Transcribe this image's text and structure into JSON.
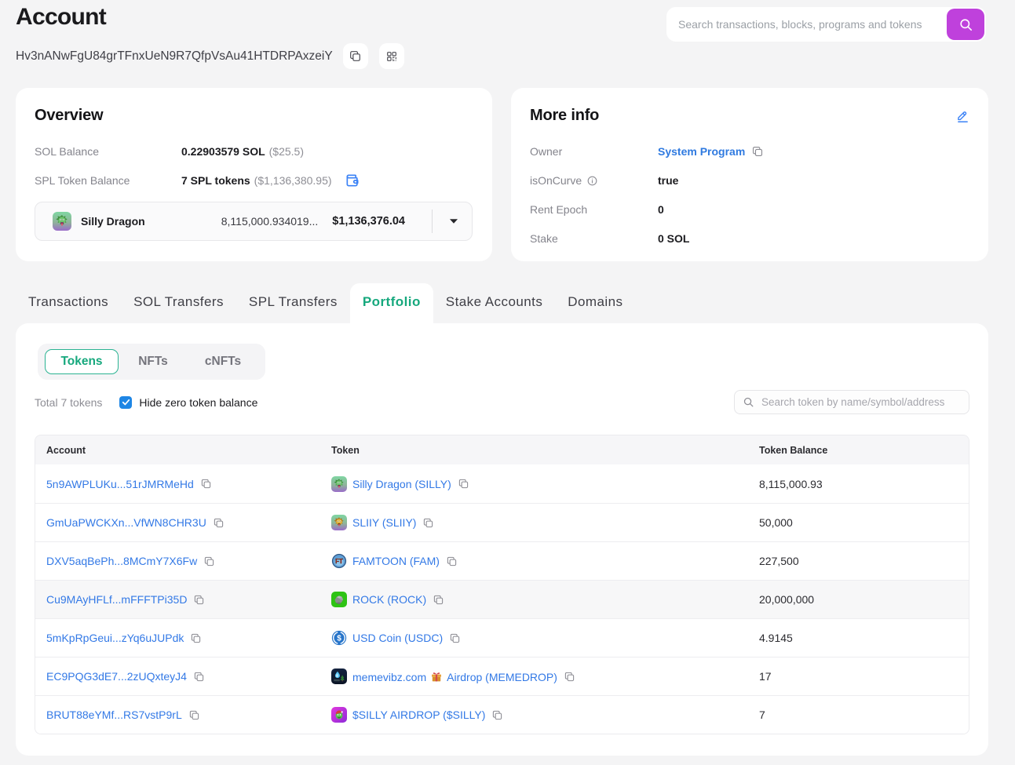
{
  "page": {
    "title": "Account"
  },
  "colors": {
    "page_background": "#f4f4f5",
    "accent_purple": "#bf41dc",
    "accent_green": "#16a87d",
    "link_blue": "#3379e6",
    "checkbox_blue": "#1e86e5",
    "icon_blue": "#3b82f6"
  },
  "top_search": {
    "placeholder": "Search transactions, blocks, programs and tokens"
  },
  "account": {
    "address": "Hv3nANwFgU84grTFnxUeN9R7QfpVsAu41HTDRPAxzeiY"
  },
  "overview": {
    "title": "Overview",
    "sol_balance": {
      "label": "SOL Balance",
      "value": "0.22903579 SOL",
      "usd": "($25.5)"
    },
    "spl_balance": {
      "label": "SPL Token Balance",
      "value": "7 SPL tokens",
      "usd": "($1,136,380.95)"
    },
    "token_select": {
      "name": "Silly Dragon",
      "amount": "8,115,000.934019...",
      "usd": "$1,136,376.04"
    }
  },
  "more_info": {
    "title": "More info",
    "rows": [
      {
        "label": "Owner",
        "value": "System Program"
      },
      {
        "label": "isOnCurve",
        "value": "true"
      },
      {
        "label": "Rent Epoch",
        "value": "0"
      },
      {
        "label": "Stake",
        "value": "0 SOL"
      }
    ]
  },
  "tabs": [
    {
      "label": "Transactions",
      "active": false
    },
    {
      "label": "SOL Transfers",
      "active": false
    },
    {
      "label": "SPL Transfers",
      "active": false
    },
    {
      "label": "Portfolio",
      "active": true
    },
    {
      "label": "Stake Accounts",
      "active": false
    },
    {
      "label": "Domains",
      "active": false
    }
  ],
  "portfolio": {
    "subtabs": [
      {
        "label": "Tokens",
        "active": true
      },
      {
        "label": "NFTs",
        "active": false
      },
      {
        "label": "cNFTs",
        "active": false
      }
    ],
    "total_text": "Total 7 tokens",
    "hide_zero": {
      "label": "Hide zero token balance",
      "checked": true
    },
    "token_search_placeholder": "Search token by name/symbol/address",
    "table": {
      "headers": [
        "Account",
        "Token",
        "Token Balance"
      ],
      "rows": [
        {
          "account": "5n9AWPLUKu...51rJMRMeHd",
          "token": "Silly Dragon (SILLY)",
          "balance": "8,115,000.93",
          "icon": "silly-dragon",
          "highlighted": false
        },
        {
          "account": "GmUaPWCKXn...VfWN8CHR3U",
          "token": "SLIIY (SLIIY)",
          "balance": "50,000",
          "icon": "sliiy",
          "highlighted": false
        },
        {
          "account": "DXV5aqBePh...8MCmY7X6Fw",
          "token": "FAMTOON (FAM)",
          "balance": "227,500",
          "icon": "famtoon",
          "highlighted": false
        },
        {
          "account": "Cu9MAyHFLf...mFFFTPi35D",
          "token": "ROCK (ROCK)",
          "balance": "20,000,000",
          "icon": "rock",
          "highlighted": true
        },
        {
          "account": "5mKpRpGeui...zYq6uJUPdk",
          "token": "USD Coin (USDC)",
          "balance": "4.9145",
          "icon": "usdc",
          "highlighted": false
        },
        {
          "account": "EC9PQG3dE7...2zUQxteyJ4",
          "token": "memevibz.com 🎁 Airdrop (MEMEDROP)",
          "token_pre": "memevibz.com",
          "token_gift": "gift-emoji",
          "token_post": "Airdrop (MEMEDROP)",
          "balance": "17",
          "icon": "memedrop",
          "highlighted": false
        },
        {
          "account": "BRUT88eYMf...RS7vstP9rL",
          "token": "$SILLY AIRDROP ($SILLY)",
          "balance": "7",
          "icon": "silly-airdrop",
          "highlighted": false
        }
      ]
    }
  }
}
